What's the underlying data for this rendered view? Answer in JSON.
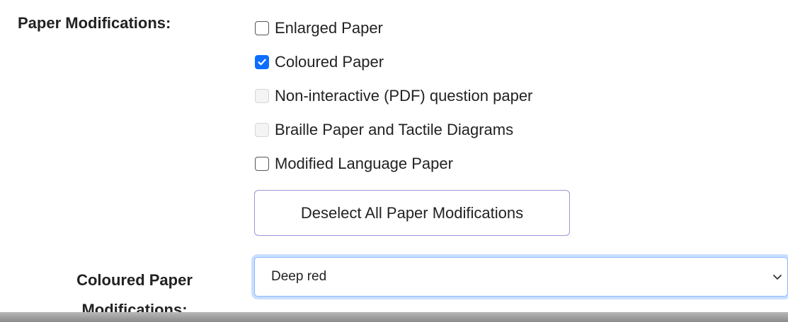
{
  "paper_modifications": {
    "label": "Paper Modifications:",
    "options": [
      {
        "label": "Enlarged Paper",
        "checked": false,
        "disabled": false
      },
      {
        "label": "Coloured Paper",
        "checked": true,
        "disabled": false
      },
      {
        "label": "Non-interactive (PDF) question paper",
        "checked": false,
        "disabled": true
      },
      {
        "label": "Braille Paper and Tactile Diagrams",
        "checked": false,
        "disabled": true
      },
      {
        "label": "Modified Language Paper",
        "checked": false,
        "disabled": false
      }
    ],
    "deselect_button_label": "Deselect All Paper Modifications"
  },
  "coloured_paper": {
    "label_line1": "Coloured Paper",
    "label_line2": "Modifications:",
    "selected_value": "Deep red",
    "icon": "chevron-down-icon"
  },
  "colors": {
    "checkbox_checked": "#0d6efd",
    "button_border": "#9b96d6",
    "select_focus": "#86b7fe"
  }
}
